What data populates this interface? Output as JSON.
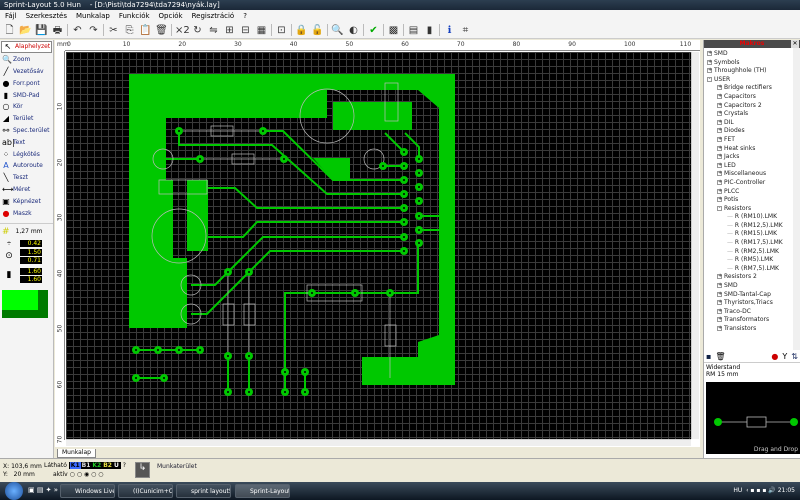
{
  "window": {
    "title": "Sprint-Layout 5.0 Hun    - [D:\\Pisti\\tda7294\\tda7294\\nyák.lay]"
  },
  "menu": [
    "Fájl",
    "Szerkesztés",
    "Munkalap",
    "Funkciók",
    "Opciók",
    "Regisztráció",
    "?"
  ],
  "toolbar": {
    "icons": [
      "new-icon",
      "open-icon",
      "save-icon",
      "print-icon",
      "undo-icon",
      "redo-icon",
      "cut-icon",
      "copy-icon",
      "paste-icon",
      "delete-icon",
      "x2-icon",
      "rotate-icon",
      "mirror-icon",
      "group-icon",
      "ungroup-icon",
      "align-icon",
      "snap-icon",
      "lock-icon",
      "unlock-icon",
      "search-icon",
      "contrast-icon",
      "check-icon",
      "export-icon",
      "gerber-icon",
      "component-icon",
      "info-icon",
      "connection-icon"
    ],
    "x2_label": "×2"
  },
  "tools": [
    {
      "label": "Alaphelyzet",
      "icon": "pointer-icon",
      "glyph": "↖"
    },
    {
      "label": "Zoom",
      "icon": "zoom-icon",
      "glyph": "🔍"
    },
    {
      "label": "Vezetősáv",
      "icon": "track-icon",
      "glyph": "╱"
    },
    {
      "label": "Forr.pont",
      "icon": "pad-icon",
      "glyph": "●"
    },
    {
      "label": "SMD-Pad",
      "icon": "smd-pad-icon",
      "glyph": "▮"
    },
    {
      "label": "Kör",
      "icon": "circle-icon",
      "glyph": "○"
    },
    {
      "label": "Terület",
      "icon": "zone-icon",
      "glyph": "◢"
    },
    {
      "label": "Spec.terület",
      "icon": "special-zone-icon",
      "glyph": "⚯"
    },
    {
      "label": "Text",
      "icon": "text-icon",
      "glyph": "ab|"
    },
    {
      "label": "Légkötés",
      "icon": "airwire-icon",
      "glyph": "⁘"
    },
    {
      "label": "Autoroute",
      "icon": "autoroute-icon",
      "glyph": "A"
    },
    {
      "label": "Teszt",
      "icon": "test-icon",
      "glyph": "╲"
    },
    {
      "label": "Méret",
      "icon": "measure-icon",
      "glyph": "⟷"
    },
    {
      "label": "Képnézet",
      "icon": "photoview-icon",
      "glyph": "▣"
    },
    {
      "label": "Maszk",
      "icon": "mask-icon",
      "glyph": "●"
    }
  ],
  "settings": {
    "grid": "1,27 mm",
    "track_width": "0.42",
    "pad_outer": "1.50",
    "pad_inner": "0.71",
    "smd_w": "1.60",
    "smd_h": "1.60"
  },
  "ruler": {
    "unit": "mm",
    "h_labels": [
      "0",
      "10",
      "20",
      "30",
      "40",
      "50",
      "60",
      "70",
      "80",
      "90",
      "100",
      "110"
    ],
    "v_labels": [
      "10",
      "20",
      "30",
      "40",
      "50",
      "60",
      "70"
    ]
  },
  "tab": "Munkalap",
  "makros": {
    "title": "Makros",
    "items": [
      {
        "label": "SMD",
        "level": 0,
        "sign": "+"
      },
      {
        "label": "Symbols",
        "level": 0,
        "sign": "+"
      },
      {
        "label": "Throughhole (TH)",
        "level": 0,
        "sign": "+"
      },
      {
        "label": "USER",
        "level": 0,
        "sign": "-"
      },
      {
        "label": "Bridge rectifiers",
        "level": 1,
        "sign": "+"
      },
      {
        "label": "Capacitors",
        "level": 1,
        "sign": "+"
      },
      {
        "label": "Capacitors 2",
        "level": 1,
        "sign": "+"
      },
      {
        "label": "Crystals",
        "level": 1,
        "sign": "+"
      },
      {
        "label": "DIL",
        "level": 1,
        "sign": "+"
      },
      {
        "label": "Diodes",
        "level": 1,
        "sign": "+"
      },
      {
        "label": "FET",
        "level": 1,
        "sign": "+"
      },
      {
        "label": "Heat sinks",
        "level": 1,
        "sign": "+"
      },
      {
        "label": "Jacks",
        "level": 1,
        "sign": "+"
      },
      {
        "label": "LED",
        "level": 1,
        "sign": "+"
      },
      {
        "label": "Miscellaneous",
        "level": 1,
        "sign": "+"
      },
      {
        "label": "PIC-Controller",
        "level": 1,
        "sign": "+"
      },
      {
        "label": "PLCC",
        "level": 1,
        "sign": "+"
      },
      {
        "label": "Potis",
        "level": 1,
        "sign": "+"
      },
      {
        "label": "Resistors",
        "level": 1,
        "sign": "-"
      },
      {
        "label": "R (RM10).LMK",
        "level": 2,
        "sign": ""
      },
      {
        "label": "R (RM12,5).LMK",
        "level": 2,
        "sign": ""
      },
      {
        "label": "R (RM15).LMK",
        "level": 2,
        "sign": ""
      },
      {
        "label": "R (RM17,5).LMK",
        "level": 2,
        "sign": ""
      },
      {
        "label": "R (RM2,5).LMK",
        "level": 2,
        "sign": ""
      },
      {
        "label": "R (RM5).LMK",
        "level": 2,
        "sign": ""
      },
      {
        "label": "R (RM7,5).LMK",
        "level": 2,
        "sign": ""
      },
      {
        "label": "Resistors 2",
        "level": 1,
        "sign": "+"
      },
      {
        "label": "SMD",
        "level": 1,
        "sign": "+"
      },
      {
        "label": "SMD-Tantal-Cap",
        "level": 1,
        "sign": "+"
      },
      {
        "label": "Thyristors,Triacs",
        "level": 1,
        "sign": "+"
      },
      {
        "label": "Traco-DC",
        "level": 1,
        "sign": "+"
      },
      {
        "label": "Transformators",
        "level": 1,
        "sign": "+"
      },
      {
        "label": "Transistors",
        "level": 1,
        "sign": "+"
      }
    ],
    "component_name": "Widerstand",
    "component_sub": "RM 15 mm",
    "drag_drop": "Drag and Drop"
  },
  "status": {
    "x_label": "X:",
    "x_value": "103,6 mm",
    "y_label": "Y:",
    "y_value": "20 mm",
    "visible_label": "Látható",
    "active_label": "aktív",
    "layers": [
      {
        "name": "K1",
        "color": "#3b6bff"
      },
      {
        "name": "B1",
        "color": "#dddddd"
      },
      {
        "name": "K2",
        "color": "#22cc22"
      },
      {
        "name": "B2",
        "color": "#e8e040"
      },
      {
        "name": "U",
        "color": "#ffffff"
      }
    ],
    "help": "?",
    "workspace": "Munkaterület"
  },
  "taskbar": {
    "items": [
      "Windows Live Mess...",
      "(I)Cunicim+Cunicill...",
      "sprint layout5",
      "Sprint-Layout 5.0"
    ],
    "lang": "HU",
    "clock": "21:05"
  },
  "colors": {
    "copper": "#00c800",
    "board": "#000000",
    "grid": "#3a3a3a"
  }
}
